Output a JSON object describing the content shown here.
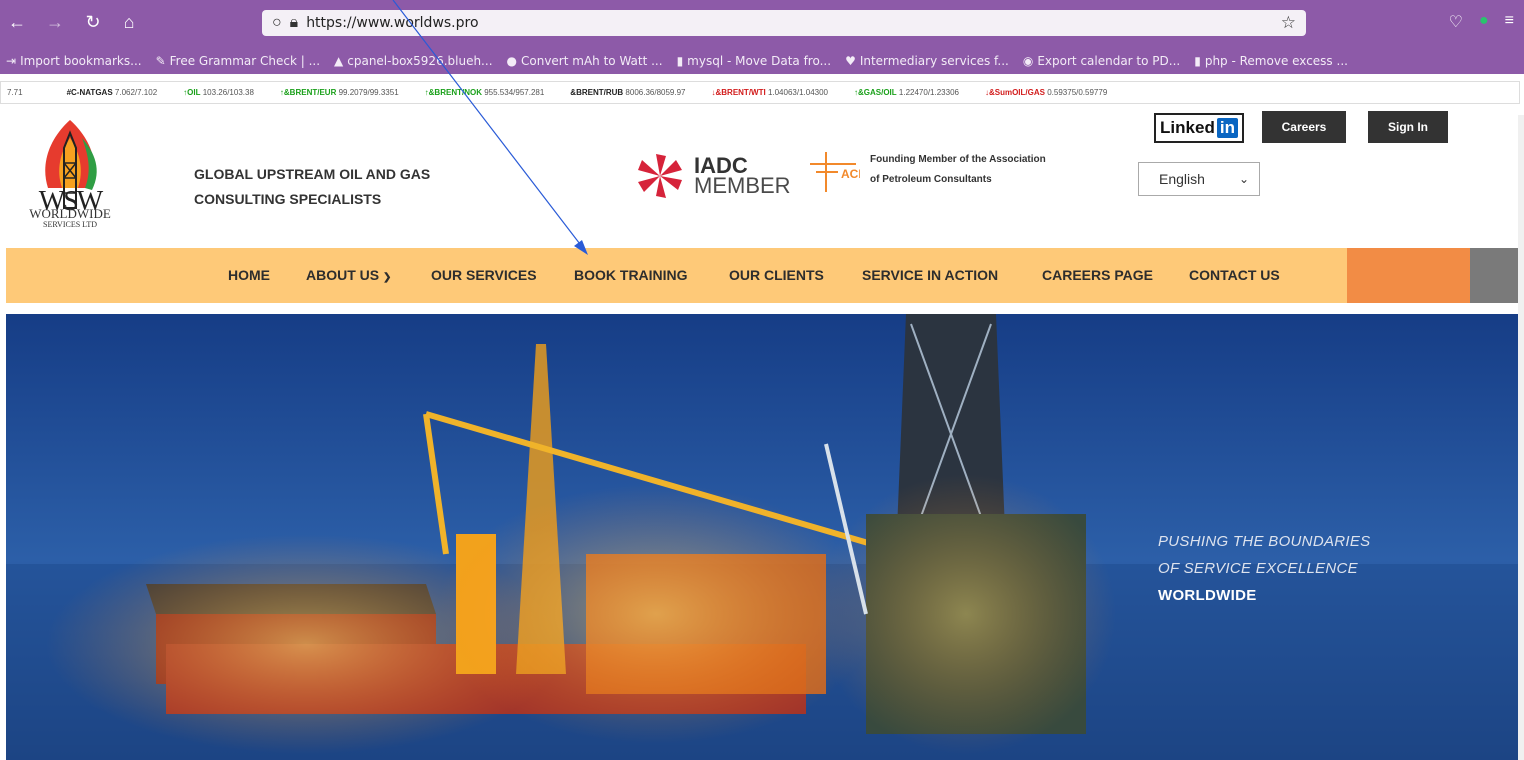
{
  "browser": {
    "url_prefix": "https://www.",
    "url_domain": "worldws.pro",
    "bookmarks": [
      {
        "label": "Import bookmarks...",
        "icon": "import-icon"
      },
      {
        "label": "Free Grammar Check | ...",
        "icon": "pen-icon"
      },
      {
        "label": "cpanel-box5926.blueh...",
        "icon": "cpanel-icon"
      },
      {
        "label": "Convert mAh to Watt ...",
        "icon": "globe-icon"
      },
      {
        "label": "mysql - Move Data fro...",
        "icon": "stackoverflow-icon"
      },
      {
        "label": "Intermediary services f...",
        "icon": "heart-icon"
      },
      {
        "label": "Export calendar to PD...",
        "icon": "github-icon"
      },
      {
        "label": "php - Remove excess ...",
        "icon": "stackoverflow-icon"
      }
    ]
  },
  "ticker": [
    {
      "name": "",
      "value": "7.71",
      "trend": ""
    },
    {
      "name": "#C-NATGAS",
      "value": "7.062/7.102",
      "trend": ""
    },
    {
      "name": "OIL",
      "value": "103.26/103.38",
      "trend": "up"
    },
    {
      "name": "&BRENT/EUR",
      "value": "99.2079/99.3351",
      "trend": "up"
    },
    {
      "name": "&BRENT/NOK",
      "value": "955.534/957.281",
      "trend": "up"
    },
    {
      "name": "&BRENT/RUB",
      "value": "8006.36/8059.97",
      "trend": ""
    },
    {
      "name": "&BRENT/WTI",
      "value": "1.04063/1.04300",
      "trend": "down"
    },
    {
      "name": "&GAS/OIL",
      "value": "1.22470/1.23306",
      "trend": "up"
    },
    {
      "name": "&SumOIL/GAS",
      "value": "0.59375/0.59779",
      "trend": "down"
    }
  ],
  "header": {
    "logo_main": "WORLDWIDE",
    "logo_sub": "SERVICES LTD",
    "tagline_1": "GLOBAL UPSTREAM OIL AND GAS",
    "tagline_2": "CONSULTING SPECIALISTS",
    "iadc_1": "IADC",
    "iadc_2": "MEMBER",
    "apc_logo": "ACP",
    "apc_1": "Founding Member of the Association",
    "apc_2": "of Petroleum Consultants",
    "linkedin": "Linked",
    "linkedin_in": "in",
    "careers": "Careers",
    "signin": "Sign In",
    "language": "English"
  },
  "nav": {
    "items": [
      "HOME",
      "ABOUT US",
      "OUR SERVICES",
      "BOOK TRAINING",
      "OUR CLIENTS",
      "SERVICE IN ACTION",
      "CAREERS PAGE",
      "CONTACT US"
    ]
  },
  "hero": {
    "line1": "PUSHING THE BOUNDARIES",
    "line2": "OF SERVICE EXCELLENCE",
    "line3": "WORLDWIDE"
  },
  "colors": {
    "browser_chrome": "#8d5aa8",
    "nav_bg": "#fec978",
    "nav_accent": "#f28c45",
    "annotation_arrow": "#2a5bd7"
  }
}
